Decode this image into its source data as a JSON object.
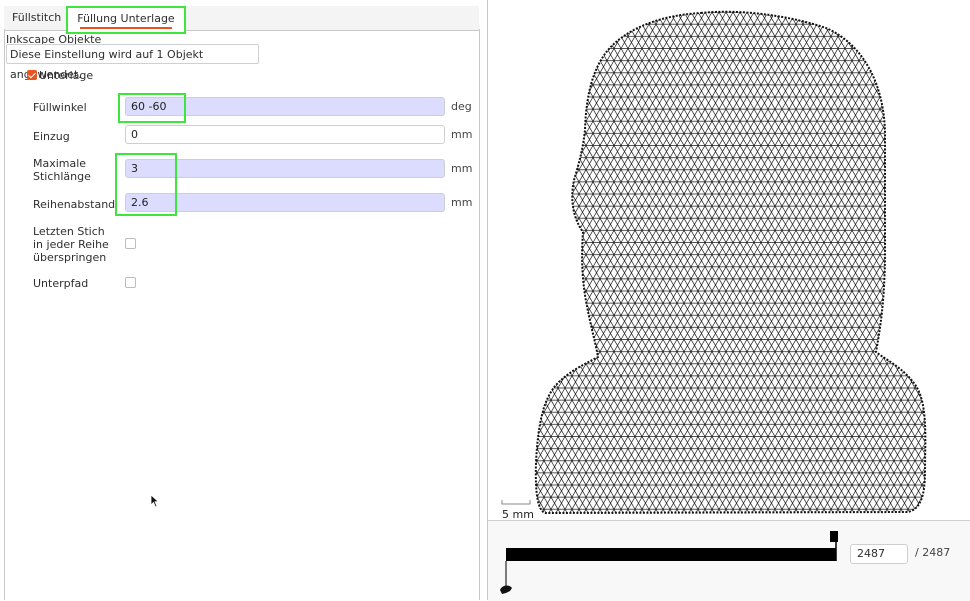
{
  "tabs": [
    {
      "label": "Füllstitch",
      "active": false
    },
    {
      "label": "Füllung Unterlage",
      "active": true
    }
  ],
  "panel": {
    "section_title": "Inkscape Objekte",
    "info": "Diese Einstellung wird auf 1 Objekt angewendet.",
    "underlay_label": "Unterlage",
    "underlay_checked": true
  },
  "fields": {
    "fill_angle": {
      "label": "Füllwinkel",
      "value": "60 -60",
      "unit": "deg"
    },
    "inset": {
      "label": "Einzug",
      "value": "0",
      "unit": "mm"
    },
    "max_stitch": {
      "label": "Maximale Stichlänge",
      "value": "3",
      "unit": "mm"
    },
    "row_spacing": {
      "label": "Reihenabstand",
      "value": "2.6",
      "unit": "mm"
    },
    "skip_last": {
      "label": "Letzten Stich in jeder Reihe überspringen",
      "checked": false
    },
    "underpath": {
      "label": "Unterpfad",
      "checked": false
    }
  },
  "preview": {
    "scale_label": "5 mm",
    "stitch_count": "2487",
    "stitch_total": "/ 2487",
    "progress": 1.0
  },
  "colors": {
    "accent": "#e95420",
    "highlight": "#3de53d",
    "field_highlight": "#dcdcff"
  }
}
